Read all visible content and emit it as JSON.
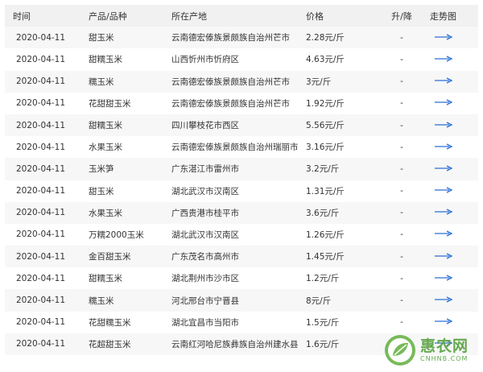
{
  "table": {
    "headers": {
      "date": "时间",
      "product": "产品/品种",
      "origin": "所在产地",
      "price": "价格",
      "change": "升/降",
      "trend": "走势图"
    },
    "rows": [
      {
        "date": "2020-04-11",
        "product": "甜玉米",
        "origin": "云南德宏傣族景颇族自治州芒市",
        "price": "2.28元/斤",
        "change": "-"
      },
      {
        "date": "2020-04-11",
        "product": "甜糯玉米",
        "origin": "山西忻州市忻府区",
        "price": "4.63元/斤",
        "change": "-"
      },
      {
        "date": "2020-04-11",
        "product": "糯玉米",
        "origin": "云南德宏傣族景颇族自治州芒市",
        "price": "3元/斤",
        "change": "-"
      },
      {
        "date": "2020-04-11",
        "product": "花甜甜玉米",
        "origin": "云南德宏傣族景颇族自治州芒市",
        "price": "1.92元/斤",
        "change": "-"
      },
      {
        "date": "2020-04-11",
        "product": "甜糯玉米",
        "origin": "四川攀枝花市西区",
        "price": "5.56元/斤",
        "change": "-"
      },
      {
        "date": "2020-04-11",
        "product": "水果玉米",
        "origin": "云南德宏傣族景颇族自治州瑞丽市",
        "price": "3.16元/斤",
        "change": "-"
      },
      {
        "date": "2020-04-11",
        "product": "玉米笋",
        "origin": "广东湛江市雷州市",
        "price": "3.2元/斤",
        "change": "-"
      },
      {
        "date": "2020-04-11",
        "product": "甜玉米",
        "origin": "湖北武汉市汉南区",
        "price": "1.31元/斤",
        "change": "-"
      },
      {
        "date": "2020-04-11",
        "product": "水果玉米",
        "origin": "广西贵港市桂平市",
        "price": "3.6元/斤",
        "change": "-"
      },
      {
        "date": "2020-04-11",
        "product": "万糯2000玉米",
        "origin": "湖北武汉市汉南区",
        "price": "1.26元/斤",
        "change": "-"
      },
      {
        "date": "2020-04-11",
        "product": "金百甜玉米",
        "origin": "广东茂名市高州市",
        "price": "1.45元/斤",
        "change": "-"
      },
      {
        "date": "2020-04-11",
        "product": "甜糯玉米",
        "origin": "湖北荆州市沙市区",
        "price": "1.2元/斤",
        "change": "-"
      },
      {
        "date": "2020-04-11",
        "product": "糯玉米",
        "origin": "河北邢台市宁晋县",
        "price": "8元/斤",
        "change": "-"
      },
      {
        "date": "2020-04-11",
        "product": "花甜糯玉米",
        "origin": "湖北宜昌市当阳市",
        "price": "1.5元/斤",
        "change": "-"
      },
      {
        "date": "2020-04-11",
        "product": "花超甜玉米",
        "origin": "云南红河哈尼族彝族自治州建水县",
        "price": "1.6元/斤",
        "change": ""
      }
    ]
  },
  "icons": {
    "trend": "arrow-right-icon",
    "watermark_logo": "leaf-logo-icon"
  },
  "colors": {
    "arrow": "#2a6fd3",
    "watermark": "#5aa342"
  },
  "watermark": {
    "cn": "惠农网",
    "en": "CNHNB.COM"
  }
}
